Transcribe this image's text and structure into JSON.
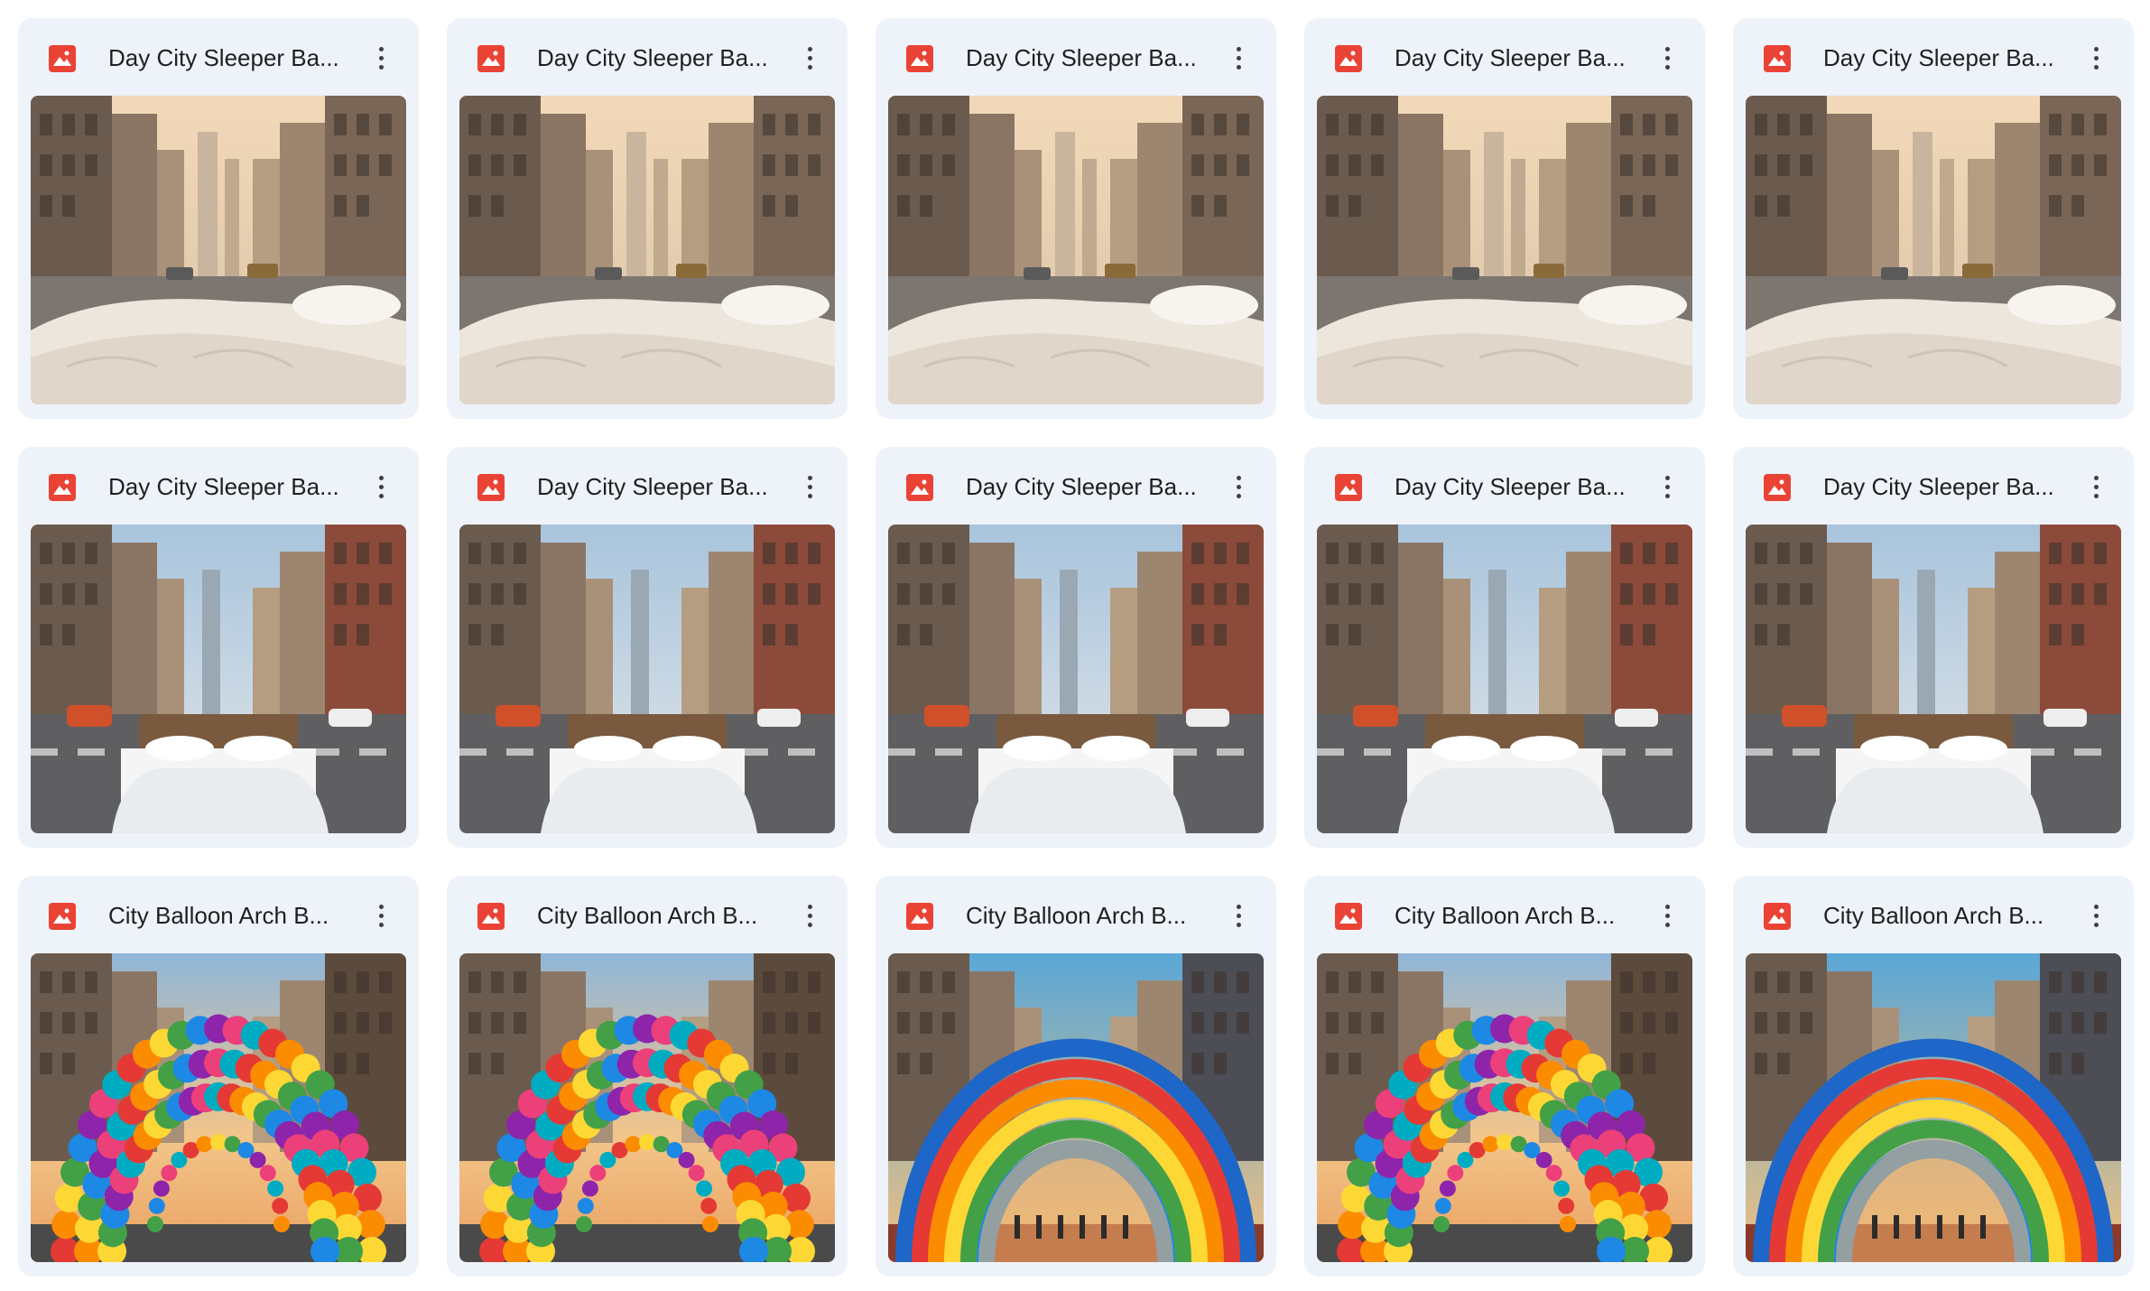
{
  "grid": {
    "cards": [
      {
        "title": "Day City Sleeper Ba...",
        "icon": "image-file-icon",
        "scene": "bed"
      },
      {
        "title": "Day City Sleeper Ba...",
        "icon": "image-file-icon",
        "scene": "bed"
      },
      {
        "title": "Day City Sleeper Ba...",
        "icon": "image-file-icon",
        "scene": "bed"
      },
      {
        "title": "Day City Sleeper Ba...",
        "icon": "image-file-icon",
        "scene": "bed"
      },
      {
        "title": "Day City Sleeper Ba...",
        "icon": "image-file-icon",
        "scene": "bed"
      },
      {
        "title": "Day City Sleeper Ba...",
        "icon": "image-file-icon",
        "scene": "bed2"
      },
      {
        "title": "Day City Sleeper Ba...",
        "icon": "image-file-icon",
        "scene": "bed2"
      },
      {
        "title": "Day City Sleeper Ba...",
        "icon": "image-file-icon",
        "scene": "bed2"
      },
      {
        "title": "Day City Sleeper Ba...",
        "icon": "image-file-icon",
        "scene": "bed2"
      },
      {
        "title": "Day City Sleeper Ba...",
        "icon": "image-file-icon",
        "scene": "bed2"
      },
      {
        "title": "City Balloon Arch B...",
        "icon": "image-file-icon",
        "scene": "balloon"
      },
      {
        "title": "City Balloon Arch B...",
        "icon": "image-file-icon",
        "scene": "balloon"
      },
      {
        "title": "City Balloon Arch B...",
        "icon": "image-file-icon",
        "scene": "inflatable"
      },
      {
        "title": "City Balloon Arch B...",
        "icon": "image-file-icon",
        "scene": "balloon"
      },
      {
        "title": "City Balloon Arch B...",
        "icon": "image-file-icon",
        "scene": "inflatable"
      }
    ]
  },
  "colors": {
    "card_bg": "#eef3fa",
    "icon_red": "#ea4335",
    "title_text": "#1f1f1f"
  }
}
